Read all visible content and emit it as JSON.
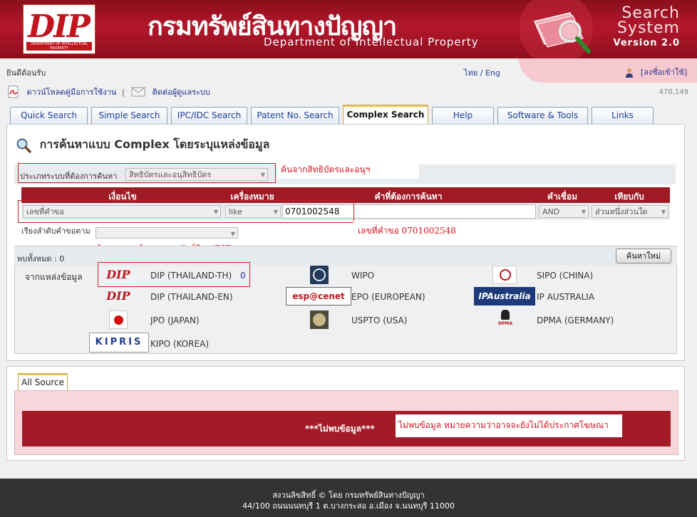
{
  "header": {
    "logo_text": "DIP",
    "logo_sub": "DEPARTMENT OF INTELLECTUAL PROPERTY",
    "title_th": "กรมทรัพย์สินทางปัญญา",
    "title_en": "Department of Intellectual Property",
    "system_line1": "Search",
    "system_line2": "System",
    "version": "Version 2.0"
  },
  "topbar": {
    "welcome": "ยินดีต้อนรับ",
    "lang_th": "ไทย",
    "lang_sep": "/",
    "lang_en": "Eng",
    "login": "[ลงชื่อเข้าใช้]"
  },
  "links": {
    "manual": "ดาวน์โหลดคู่มือการใช้งาน",
    "sep": "|",
    "contact": "ติดต่อผู้ดูแลระบบ",
    "counter": "478,149"
  },
  "tabs": [
    {
      "label": "Quick Search"
    },
    {
      "label": "Simple Search"
    },
    {
      "label": "IPC/IDC Search"
    },
    {
      "label": "Patent No. Search"
    },
    {
      "label": "Complex Search"
    },
    {
      "label": "Help"
    },
    {
      "label": "Software & Tools"
    },
    {
      "label": "Links"
    }
  ],
  "panel": {
    "title": "การค้นหาแบบ Complex โดยระบุแหล่งข้อมูล",
    "system_label": "ประเภทระบบที่ต้องการค้นหา",
    "system_value": "สิทธิบัตรและอนุสิทธิบัตร",
    "annot_system": "ค้นจากสิทธิบัตรและอนุฯ",
    "grid_headers": [
      "เงื่อนไข",
      "เครื่องหมาย",
      "คำที่ต้องการค้นหา",
      "คำเชื่อม",
      "เทียบกับ"
    ],
    "condition": "เลขที่คำขอ",
    "operator": "like",
    "search_value": "0701002548",
    "connector": "AND",
    "compare": "ส่วนหนึ่งส่วนใด",
    "sort_label": "เรียงลำดับคำขอตาม",
    "annot_number": "เลขที่คำขอ 0701002548",
    "annot_db": "ค้นจากฐานข้อมูลกรมทรัพย์สินฯ(DIP)",
    "found_label": "พบทั้งหมด :",
    "found_count": "0",
    "new_search": "ค้นหาใหม่",
    "from_source": "จากแหล่งข้อมูล"
  },
  "sources": {
    "dip_th": "DIP (THAILAND-TH)",
    "dip_th_count": "0",
    "dip_en": "DIP (THAILAND-EN)",
    "jpo": "JPO (JAPAN)",
    "kipo": "KIPO (KOREA)",
    "wipo": "WIPO",
    "epo": "EPO (EUROPEAN)",
    "uspto": "USPTO (USA)",
    "sipo": "SIPO (CHINA)",
    "ip_australia": "IP AUSTRALIA",
    "dpma": "DPMA (GERMANY)",
    "logo_kipris": "KIPRIS",
    "logo_espacenet": "esp@cenet",
    "logo_ipaustralia": "IPAustralia",
    "logo_dpma": "DPMA",
    "logo_dip": "DIP"
  },
  "result": {
    "tab_label": "All Source",
    "not_found": "***ไม่พบข้อมูล***",
    "annot_not_found": "ไม่พบข้อมูล หมายความว่าอาจจะยังไม่ได้ประกาศโฆษณา"
  },
  "footer": {
    "line1": "สงวนลิขสิทธิ์ © โดย กรมทรัพย์สินทางปัญญา",
    "line2": "44/100 ถนนนนทบุรี 1 ต.บางกระสอ อ.เมือง จ.นนทบุรี 11000"
  },
  "colors": {
    "header_red": "#b3172b",
    "grid_head": "#9e1a24",
    "result_bar": "#a31b26",
    "annotation_red": "#d8151e",
    "link_blue": "#1f2f8e"
  }
}
